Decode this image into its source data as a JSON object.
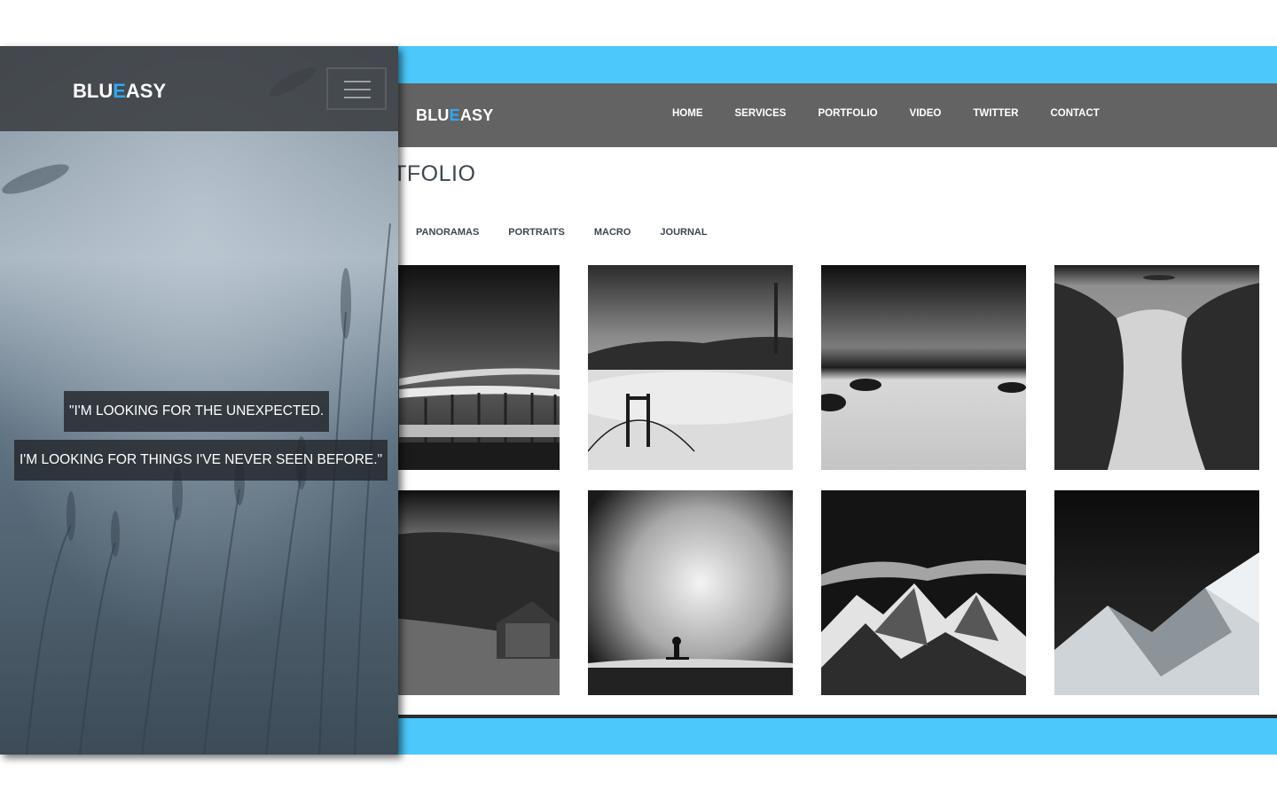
{
  "desktop": {
    "logo": {
      "part1": "BLU",
      "accent": "E",
      "part2": "ASY"
    },
    "menu": [
      "HOME",
      "SERVICES",
      "PORTFOLIO",
      "VIDEO",
      "TWITTER",
      "CONTACT"
    ],
    "heading": "RTFOLIO",
    "filters": [
      "PANORAMAS",
      "PORTRAITS",
      "MACRO",
      "JOURNAL"
    ],
    "gallery": [
      {
        "subject": "pier-in-fog"
      },
      {
        "subject": "bridge-in-fog"
      },
      {
        "subject": "seascape-rocks"
      },
      {
        "subject": "misty-river-rocks"
      },
      {
        "subject": "cabin-in-forest"
      },
      {
        "subject": "surfer-big-wave"
      },
      {
        "subject": "snowy-mountains"
      },
      {
        "subject": "snowy-peak"
      }
    ]
  },
  "mobile": {
    "logo": {
      "part1": "BLU",
      "accent": "E",
      "part2": "ASY"
    },
    "quotes": [
      "\"I'M LOOKING FOR THE UNEXPECTED.",
      "I'M LOOKING FOR THINGS I'VE NEVER SEEN BEFORE.\""
    ]
  },
  "colors": {
    "accent": "#2fa7f4",
    "frame": "#4cc8fb",
    "nav": "#636363",
    "text_dark": "#3c4650"
  }
}
